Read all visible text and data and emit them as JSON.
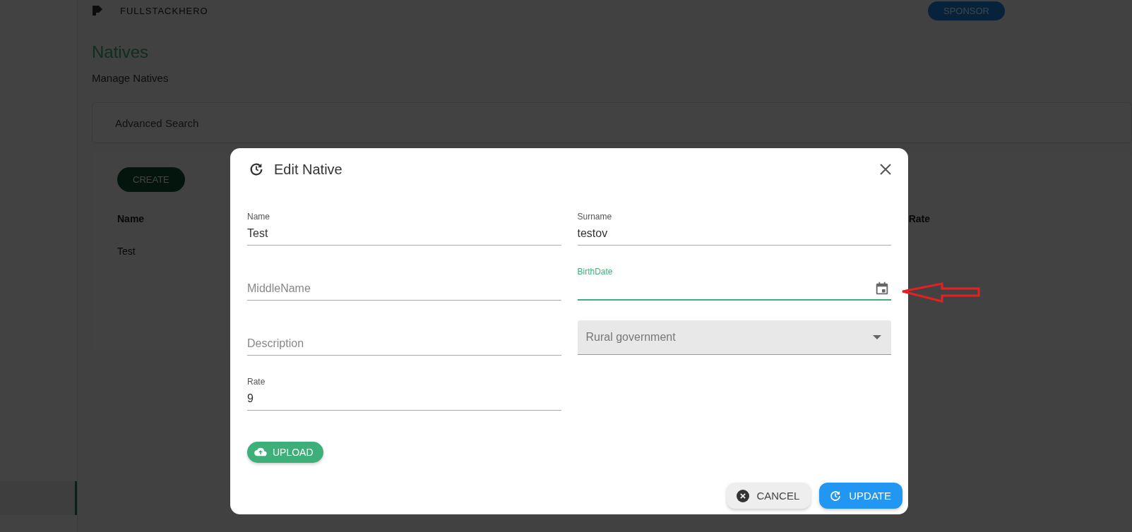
{
  "app_bar": {
    "brand": "FULLSTACKHERO",
    "sponsor_button": "SPONSOR"
  },
  "page": {
    "title": "Natives",
    "subtitle": "Manage Natives",
    "search_panel": "Advanced Search",
    "create_button": "CREATE",
    "table": {
      "columns": [
        "Name",
        "Rate"
      ],
      "rows": [
        [
          "Test"
        ]
      ]
    }
  },
  "dialog": {
    "title": "Edit Native",
    "fields": [
      {
        "kind": "text",
        "label": "Name",
        "value": "Test"
      },
      {
        "kind": "text",
        "label": "Surname",
        "value": "testov"
      },
      {
        "kind": "text",
        "placeholder": "MiddleName"
      },
      {
        "kind": "date",
        "label": "BirthDate",
        "focused": true
      },
      {
        "kind": "text",
        "placeholder": "Description"
      },
      {
        "kind": "select",
        "placeholder": "Rural government"
      },
      {
        "kind": "text",
        "label": "Rate",
        "value": "9"
      }
    ],
    "upload_button": "UPLOAD",
    "buttons": [
      {
        "kind": "cancel",
        "label": "CANCEL"
      },
      {
        "kind": "update",
        "label": "UPDATE"
      }
    ]
  }
}
